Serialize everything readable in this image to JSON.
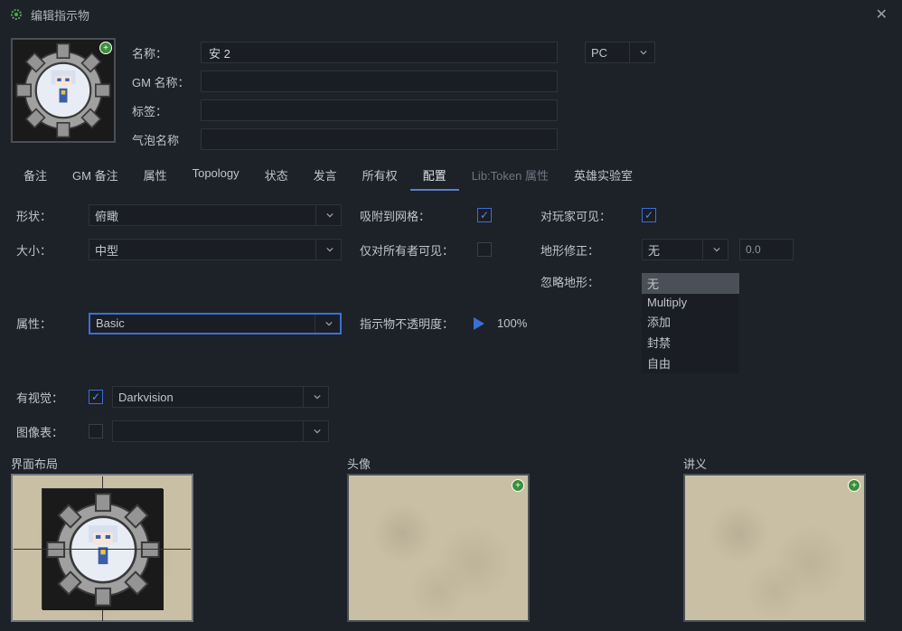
{
  "window": {
    "title": "编辑指示物"
  },
  "header": {
    "name_label": "名称：",
    "name_value": "安 2",
    "gm_name_label": "GM 名称：",
    "gm_name_value": "",
    "tags_label": "标签：",
    "tags_value": "",
    "bubble_label": "气泡名称",
    "bubble_value": "",
    "type_value": "PC"
  },
  "tabs": [
    {
      "label": "备注"
    },
    {
      "label": "GM 备注"
    },
    {
      "label": "属性"
    },
    {
      "label": "Topology"
    },
    {
      "label": "状态"
    },
    {
      "label": "发言"
    },
    {
      "label": "所有权"
    },
    {
      "label": "配置",
      "selected": true
    },
    {
      "label": "Lib:Token 属性",
      "lib": true
    },
    {
      "label": "英雄实验室"
    }
  ],
  "config": {
    "shape_label": "形状：",
    "shape_value": "俯瞰",
    "snap_label": "吸附到网格：",
    "snap_checked": true,
    "visible_label": "对玩家可见：",
    "visible_checked": true,
    "size_label": "大小：",
    "size_value": "中型",
    "owner_only_label": "仅对所有者可见：",
    "owner_only_checked": false,
    "terrain_mod_label": "地形修正：",
    "terrain_mod_value": "无",
    "terrain_mod_num": "0.0",
    "prop_label": "属性：",
    "prop_value": "Basic",
    "opacity_label": "指示物不透明度：",
    "opacity_value": "100%",
    "ignore_terrain_label": "忽略地形：",
    "ignore_terrain_options": [
      "无",
      "Multiply",
      "添加",
      "封禁",
      "自由"
    ],
    "ignore_terrain_selected": "无",
    "vision_label": "有视觉：",
    "vision_checked": true,
    "vision_value": "Darkvision",
    "image_table_label": "图像表：",
    "image_table_checked": false,
    "image_table_value": ""
  },
  "previews": {
    "layout_label": "界面布局",
    "portrait_label": "头像",
    "handout_label": "讲义"
  },
  "icons": {
    "gear": "gear-icon",
    "plus": "plus-icon",
    "close": "close-icon",
    "chevron": "chevron-down-icon"
  }
}
